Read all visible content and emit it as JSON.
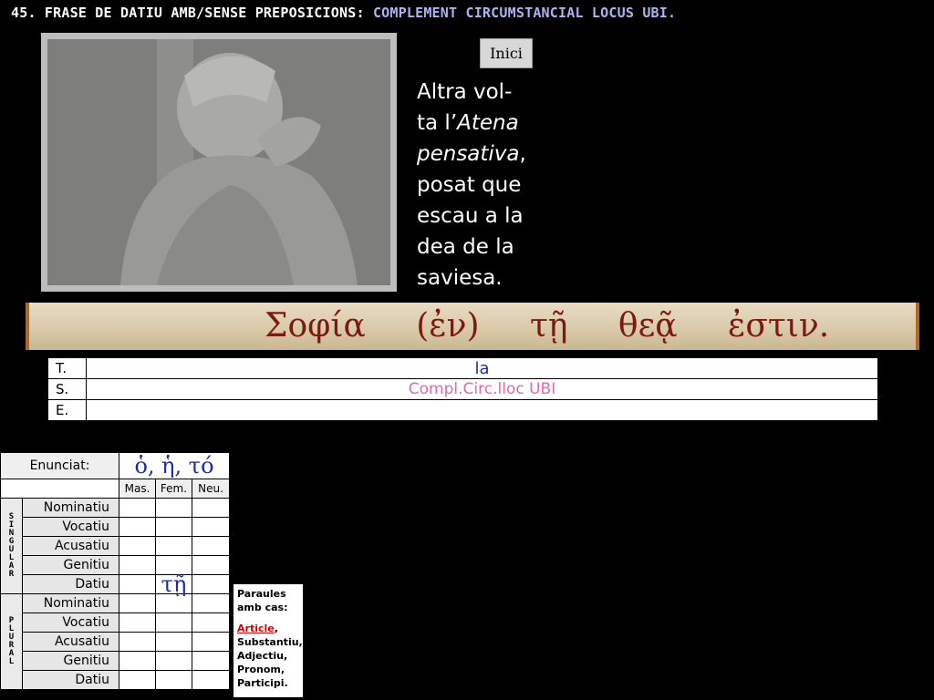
{
  "header": {
    "title_main": "45. FRASE DE DATIU AMB/SENSE PREPOSICIONS:",
    "title_highlight": "COMPLEMENT CIRCUMSTANCIAL LOCUS UBI."
  },
  "nav": {
    "home_label": "Inici"
  },
  "caption": {
    "line1": "Altra vol-",
    "line2_pre": "ta l’",
    "line2_it": "Atena",
    "line3_it": "pensativa",
    "line3_post": ",",
    "line4": "posat que",
    "line5": "escau a la",
    "line6": "dea de la",
    "line7": "saviesa."
  },
  "greek_sentence": [
    "Σοφία",
    "(ἐν)",
    "τῇ",
    "θεᾷ",
    "ἐστιν."
  ],
  "tse_table": {
    "rows": [
      {
        "label": "T.",
        "value": "la"
      },
      {
        "label": "S.",
        "value": "Compl.Circ.lloc UBI"
      },
      {
        "label": "E.",
        "value": ""
      }
    ]
  },
  "declension": {
    "enunciat_label": "Enunciat:",
    "article_forms": "ὁ, ἡ, τό",
    "genders": [
      "Mas.",
      "Fem.",
      "Neu."
    ],
    "singular_label": "SINGULAR",
    "plural_label": "PLURAL",
    "cases": [
      "Nominatiu",
      "Vocatiu",
      "Acusatiu",
      "Genitiu",
      "Datiu"
    ],
    "dative_fem_sg": "τῇ"
  },
  "words_box": {
    "line1": "Paraules",
    "line2": "amb cas:",
    "active": "Article",
    "rest1": "Substantiu,",
    "rest2": "Adjectiu,",
    "rest3": "Pronom,",
    "rest4": "Participi."
  },
  "colors": {
    "background": "#000000",
    "title_highlight": "#aab4f0",
    "greek_text": "#7a1a12",
    "blue_value": "#1c2e9a",
    "pink_value": "#e06aa8"
  }
}
